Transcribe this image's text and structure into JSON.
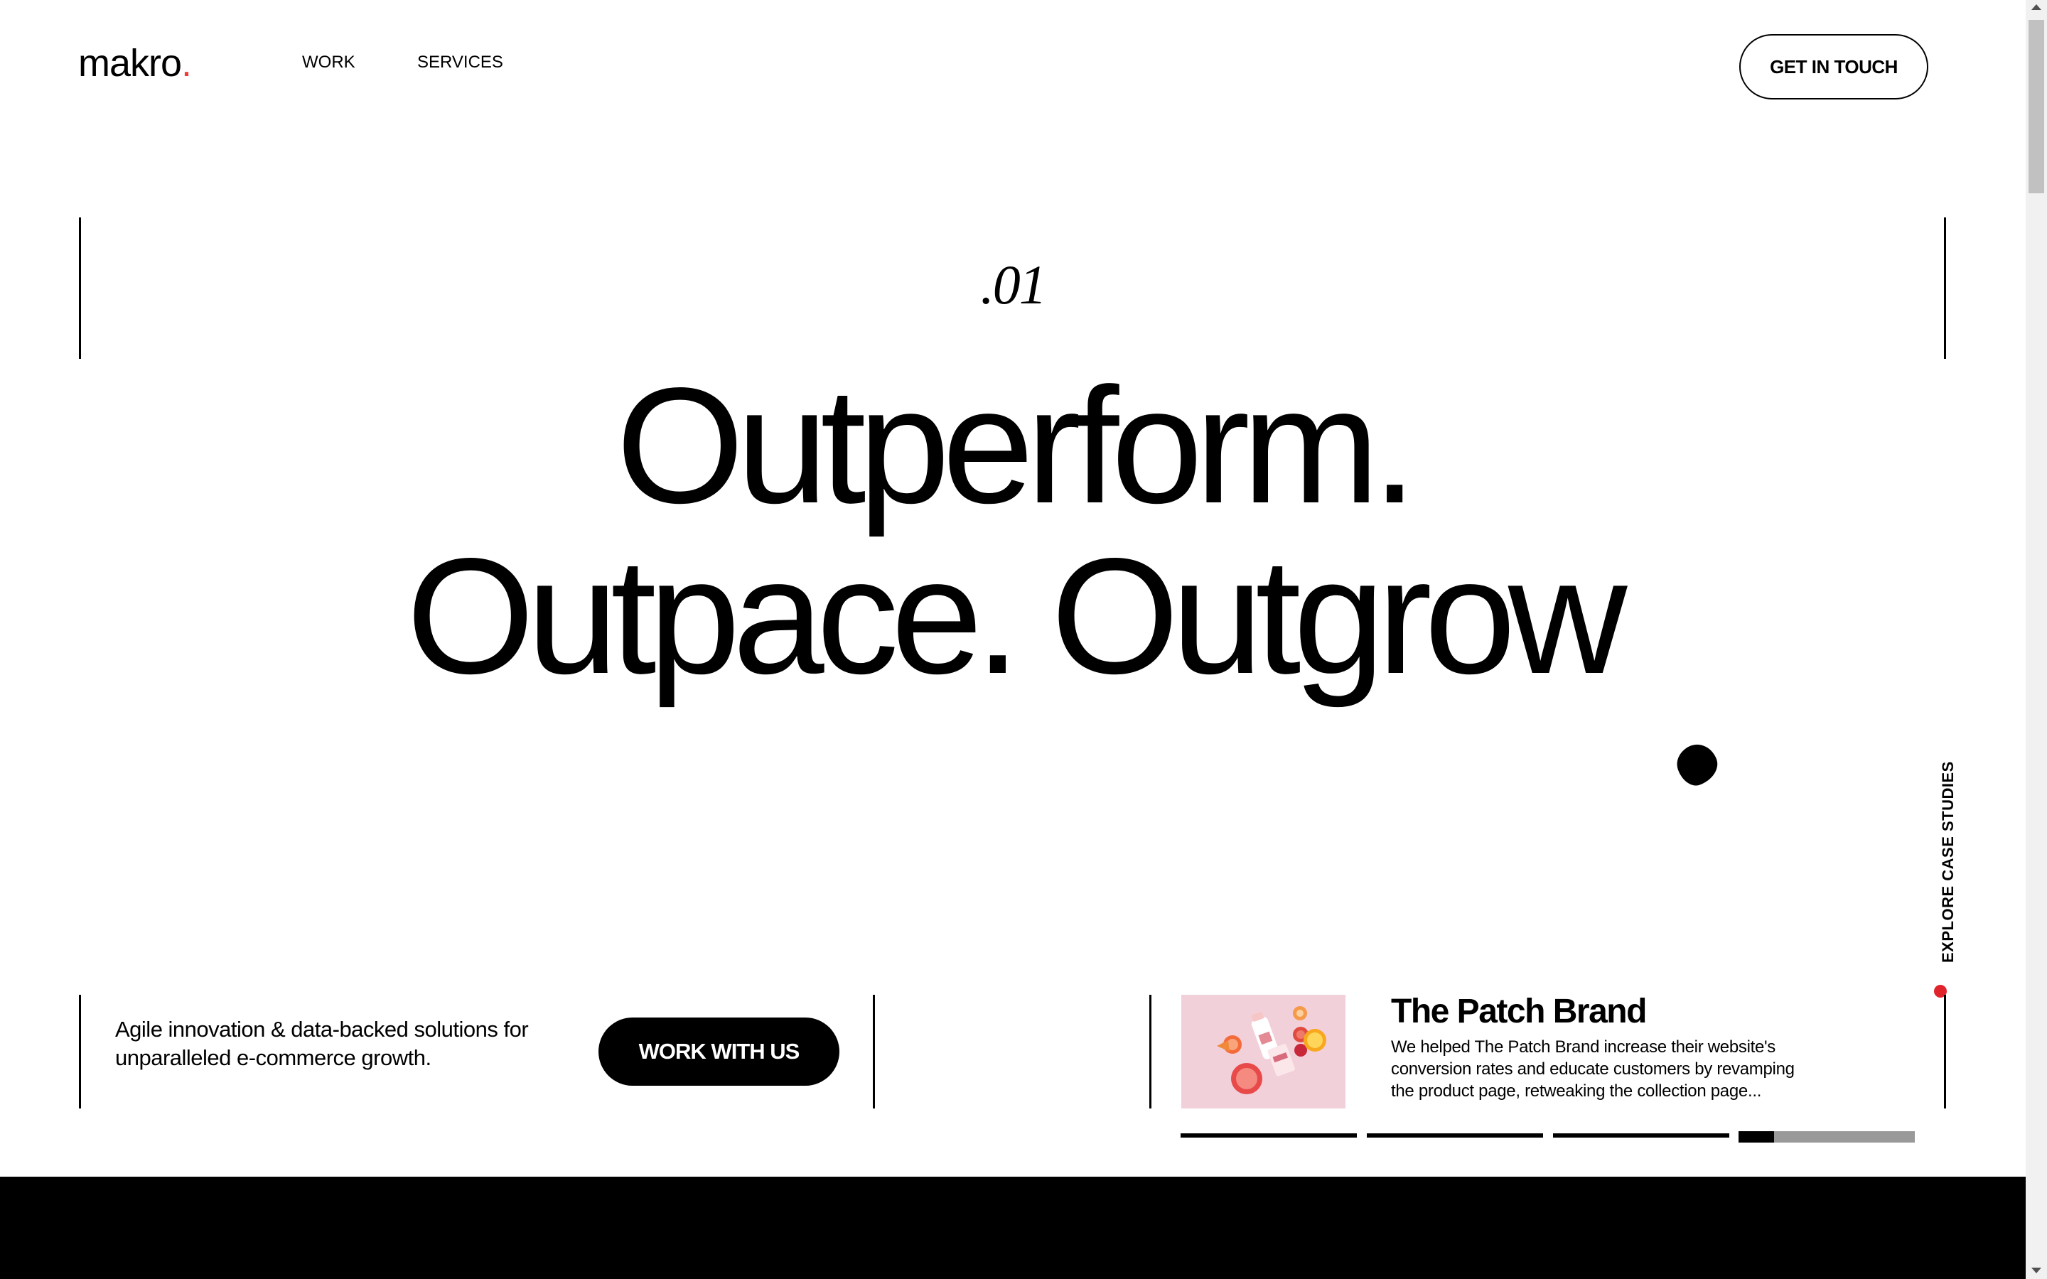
{
  "header": {
    "logo_text": "makro",
    "logo_dot": ".",
    "nav": [
      {
        "label": "WORK"
      },
      {
        "label": "SERVICES"
      }
    ],
    "cta_label": "GET IN TOUCH"
  },
  "hero": {
    "index": ".01",
    "headline_line1": "Outperform.",
    "headline_line2": "Outpace. Outgrow"
  },
  "side": {
    "explore_label": "EXPLORE CASE STUDIES"
  },
  "intro": {
    "tagline": "Agile innovation & data-backed solutions for unparalleled e-commerce growth.",
    "cta_label": "WORK WITH US"
  },
  "case_study": {
    "title": "The Patch Brand",
    "description": "We helped The Patch Brand increase their website's conversion rates and educate customers by revamping the product page, retweaking the collection page...",
    "slides_total": 4,
    "active_slide": 4,
    "active_progress": 0.2
  },
  "colors": {
    "accent": "#f03a3a",
    "black": "#000000",
    "thumb_bg": "#f2d0da"
  }
}
